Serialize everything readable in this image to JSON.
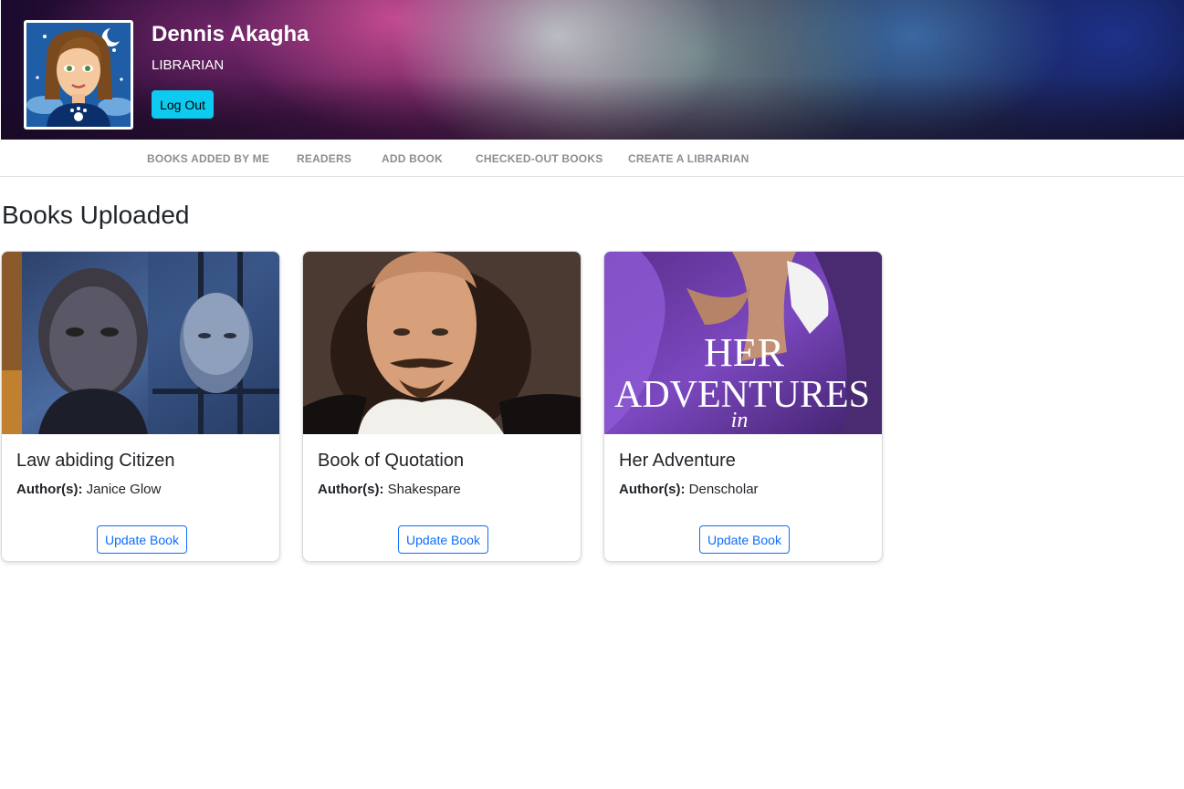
{
  "profile": {
    "name": "Dennis Akagha",
    "role": "LIBRARIAN",
    "logout_label": "Log Out",
    "avatar_icon": "cartoon-avatar"
  },
  "nav": {
    "items": [
      {
        "label": "BOOKS ADDED BY ME"
      },
      {
        "label": "READERS"
      },
      {
        "label": "ADD BOOK"
      },
      {
        "label": "CHECKED-OUT BOOKS"
      },
      {
        "label": "CREATE A LIBRARIAN"
      }
    ]
  },
  "main": {
    "title": "Books Uploaded",
    "author_label": "Author(s):",
    "books": [
      {
        "title": "Law abiding Citizen",
        "author": "Janice Glow",
        "button": "Update Book"
      },
      {
        "title": "Book of Quotation",
        "author": "Shakespare",
        "button": "Update Book"
      },
      {
        "title": "Her Adventure",
        "author": "Denscholar",
        "button": "Update Book",
        "cover_text_1": "HER",
        "cover_text_2": "ADVENTURES",
        "cover_text_3": "in"
      }
    ]
  },
  "colors": {
    "accent": "#0dcaf0",
    "primary": "#0d6efd",
    "nav_text": "#8a8f94"
  }
}
